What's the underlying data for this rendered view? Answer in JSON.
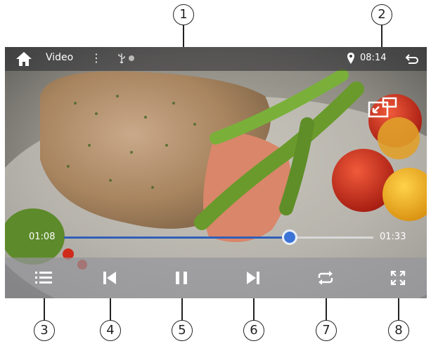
{
  "topbar": {
    "title": "Video",
    "menu_glyph": "⋮",
    "time": "08:14",
    "icons": [
      "home-icon",
      "menu-icon",
      "usb-icon",
      "status-dot",
      "location-icon",
      "back-icon"
    ]
  },
  "overlay": {
    "pip_icon": "picture-in-picture-icon"
  },
  "playback": {
    "current_time": "01:08",
    "total_time": "01:33",
    "progress": 0.73
  },
  "controls": [
    {
      "name": "playlist-button",
      "icon": "list-icon"
    },
    {
      "name": "previous-button",
      "icon": "skip-previous-icon"
    },
    {
      "name": "pause-button",
      "icon": "pause-icon"
    },
    {
      "name": "next-button",
      "icon": "skip-next-icon"
    },
    {
      "name": "repeat-button",
      "icon": "repeat-icon"
    },
    {
      "name": "fullscreen-button",
      "icon": "fullscreen-icon"
    }
  ],
  "callouts": {
    "c1": "1",
    "c2": "2",
    "c3": "3",
    "c4": "4",
    "c5": "5",
    "c6": "6",
    "c7": "7",
    "c8": "8"
  },
  "colors": {
    "accent": "#3b74d6",
    "progress_fill": "#2f5fb8",
    "topbar_bg": "rgba(40,40,45,0.55)",
    "controls_bg": "rgba(150,150,155,0.72)"
  }
}
